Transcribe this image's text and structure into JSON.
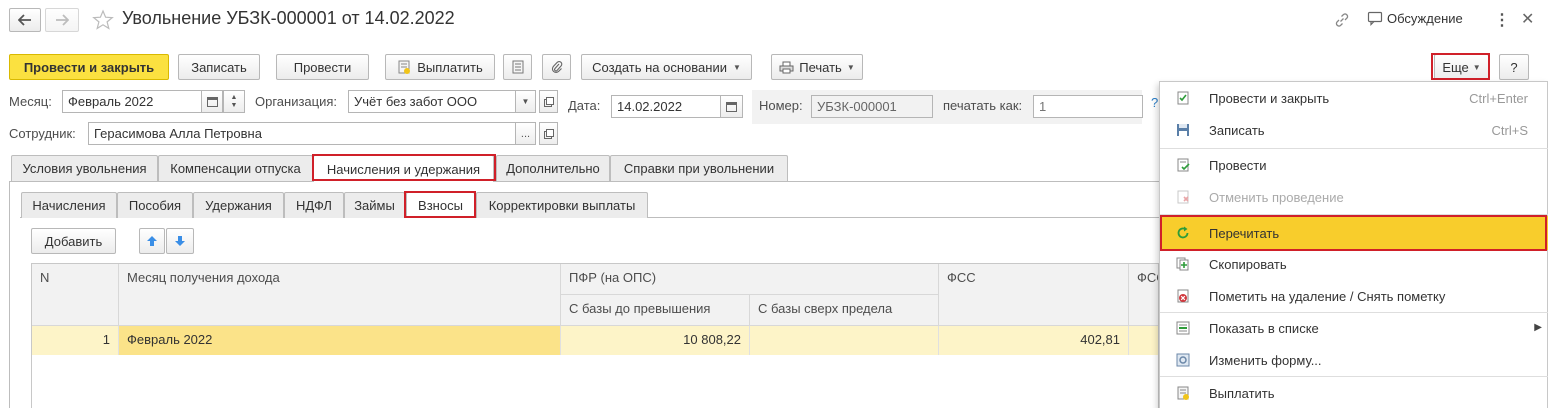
{
  "window": {
    "title": "Увольнение УБЗК-000001 от 14.02.2022",
    "discussion_label": "Обсуждение"
  },
  "toolbar": {
    "post_close": "Провести и закрыть",
    "save": "Записать",
    "post": "Провести",
    "pay": "Выплатить",
    "create_based": "Создать на основании",
    "print": "Печать",
    "more": "Еще",
    "help": "?"
  },
  "form": {
    "month_label": "Месяц:",
    "month_value": "Февраль 2022",
    "org_label": "Организация:",
    "org_value": "Учёт без забот ООО",
    "date_label": "Дата:",
    "date_value": "14.02.2022",
    "number_label": "Номер:",
    "number_value": "УБЗК-000001",
    "print_as_label": "печатать как:",
    "print_as_placeholder": "1",
    "employee_label": "Сотрудник:",
    "employee_value": "Герасимова Алла Петровна",
    "ellipsis": "...",
    "help_mark": "?"
  },
  "tabs": [
    {
      "label": "Условия увольнения"
    },
    {
      "label": "Компенсации отпуска"
    },
    {
      "label": "Начисления и удержания"
    },
    {
      "label": "Дополнительно"
    },
    {
      "label": "Справки при увольнении"
    }
  ],
  "subtabs": [
    {
      "label": "Начисления"
    },
    {
      "label": "Пособия"
    },
    {
      "label": "Удержания"
    },
    {
      "label": "НДФЛ"
    },
    {
      "label": "Займы"
    },
    {
      "label": "Взносы"
    },
    {
      "label": "Корректировки выплаты"
    }
  ],
  "table_toolbar": {
    "add": "Добавить"
  },
  "table": {
    "headers": {
      "n": "N",
      "month": "Месяц получения дохода",
      "pfr": "ПФР (на ОПС)",
      "pfr_under": "С базы до превышения",
      "pfr_over": "С базы сверх предела",
      "fss": "ФСС",
      "fss2": "ФСС"
    },
    "rows": [
      {
        "n": "1",
        "month": "Февраль 2022",
        "pfr_under": "10 808,22",
        "pfr_over": "",
        "fss": "402,81"
      }
    ]
  },
  "menu": {
    "items": [
      {
        "label": "Провести и закрыть",
        "shortcut": "Ctrl+Enter",
        "icon": "post-close-icon",
        "disabled": false
      },
      {
        "label": "Записать",
        "shortcut": "Ctrl+S",
        "icon": "save-icon",
        "disabled": false
      },
      {
        "label": "Провести",
        "shortcut": "",
        "icon": "post-icon",
        "disabled": false
      },
      {
        "label": "Отменить проведение",
        "shortcut": "",
        "icon": "unpost-icon",
        "disabled": true
      },
      {
        "label": "Перечитать",
        "shortcut": "",
        "icon": "reread-icon",
        "disabled": false,
        "highlighted": true
      },
      {
        "label": "Скопировать",
        "shortcut": "",
        "icon": "copy-icon",
        "disabled": false
      },
      {
        "label": "Пометить на удаление / Снять пометку",
        "shortcut": "",
        "icon": "delete-mark-icon",
        "disabled": false
      },
      {
        "label": "Показать в списке",
        "shortcut": "",
        "icon": "show-in-list-icon",
        "disabled": false,
        "submenu": true
      },
      {
        "label": "Изменить форму...",
        "shortcut": "",
        "icon": "change-form-icon",
        "disabled": false
      },
      {
        "label": "Выплатить",
        "shortcut": "",
        "icon": "pay-icon",
        "disabled": false
      }
    ]
  },
  "colors": {
    "accent_yellow": "#fbe140",
    "row_highlight": "#fdf4c8",
    "highlight_border": "#d02029"
  }
}
